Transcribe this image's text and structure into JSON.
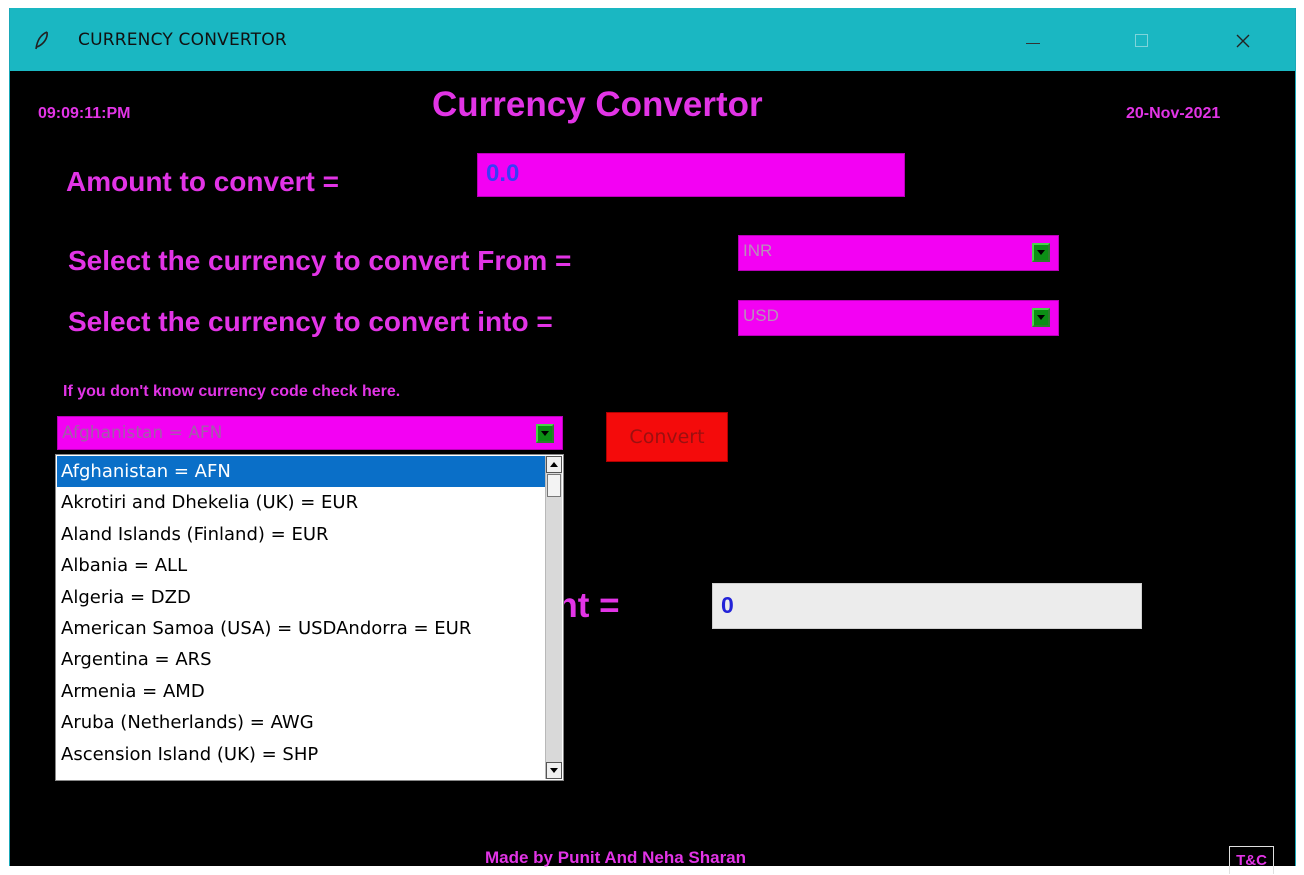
{
  "window": {
    "title": "CURRENCY CONVERTOR",
    "icon": "feather-icon",
    "title_color": "#1ab7c2"
  },
  "header": {
    "time": "09:09:11:PM",
    "title": "Currency Convertor",
    "date": "20-Nov-2021"
  },
  "form": {
    "amount_label": "Amount to convert  =",
    "amount_value": "0.0",
    "from_label": "Select the currency to convert From =",
    "from_value": "INR",
    "into_label": "Select the currency to convert into =",
    "into_value": "USD",
    "hint": "If you don't know currency code check here.",
    "country_selected": "Afghanistan = AFN",
    "convert_label": "Convert",
    "converted_label": "unt =",
    "converted_value": "0"
  },
  "dropdown": {
    "items": [
      "Afghanistan = AFN",
      "Akrotiri and Dhekelia (UK) = EUR",
      "Aland Islands (Finland) = EUR",
      "Albania = ALL",
      "Algeria = DZD",
      "American Samoa (USA) = USDAndorra = EUR",
      "Argentina = ARS",
      "Armenia = AMD",
      "Aruba (Netherlands) = AWG",
      "Ascension Island (UK) = SHP"
    ],
    "selected_index": 0
  },
  "footer": {
    "credit": "Made by Punit And Neha Sharan",
    "tc_label": "T&C"
  },
  "colors": {
    "accent": "#e234e6",
    "field_bg": "#f301f3",
    "convert_bg": "#f40b0b",
    "arrow_bg": "#0c8f15",
    "selection": "#0a6fc8"
  }
}
